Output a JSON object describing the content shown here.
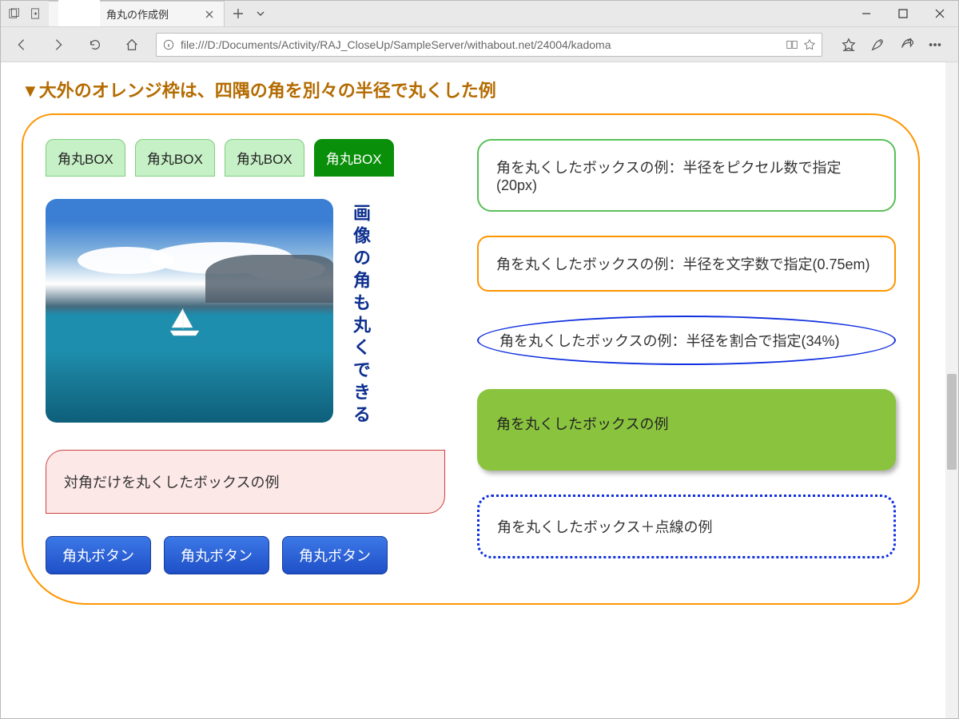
{
  "window": {
    "tab_title": "角丸の作成例",
    "address": "file:///D:/Documents/Activity/RAJ_CloseUp/SampleServer/withabout.net/24004/kadoma"
  },
  "page": {
    "heading": "▼大外のオレンジ枠は、四隅の角を別々の半径で丸くした例",
    "tab_boxes": [
      "角丸BOX",
      "角丸BOX",
      "角丸BOX",
      "角丸BOX"
    ],
    "vertical_caption": "画像の角も丸くできる",
    "diag_box": "対角だけを丸くしたボックスの例",
    "buttons": [
      "角丸ボタン",
      "角丸ボタン",
      "角丸ボタン"
    ],
    "box_px": "角を丸くしたボックスの例：半径をピクセル数で指定(20px)",
    "box_em": "角を丸くしたボックスの例：半径を文字数で指定(0.75em)",
    "box_pct": "角を丸くしたボックスの例：半径を割合で指定(34%)",
    "box_fill": "角を丸くしたボックスの例",
    "box_dotted": "角を丸くしたボックス＋点線の例"
  }
}
